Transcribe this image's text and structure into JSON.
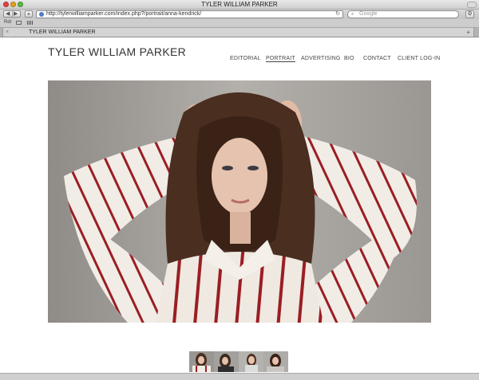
{
  "window": {
    "title": "TYLER WILLIAM PARKER"
  },
  "toolbar": {
    "back_icon": "◀",
    "forward_icon": "▶",
    "new_tab_icon": "+",
    "url": "http://tylerwilliamparker.com/index.php?/portrait/anna-kendrick/",
    "reload_icon": "↻",
    "search_placeholder": "Google",
    "search_icon": "⌕",
    "gear_icon": "⚙"
  },
  "bookmarks": {
    "reader_label": "Rdr"
  },
  "tab": {
    "label": "TYLER WILLIAM PARKER",
    "close_icon": "×",
    "new_tab_icon": "+"
  },
  "site": {
    "title": "TYLER WILLIAM PARKER",
    "nav": [
      {
        "label": "EDITORIAL",
        "active": false
      },
      {
        "label": "PORTRAIT",
        "active": true
      },
      {
        "label": "ADVERTISING",
        "active": false
      },
      {
        "label": "BIO",
        "active": false
      },
      {
        "label": "CONTACT",
        "active": false
      },
      {
        "label": "CLIENT LOG-IN",
        "active": false
      }
    ]
  },
  "colors": {
    "photo_background": "#a8a5a0",
    "hair": "#4a2e1f",
    "blouse": "#f1ece6",
    "stripe": "#9a1e23",
    "skin": "#e6c3ae"
  }
}
